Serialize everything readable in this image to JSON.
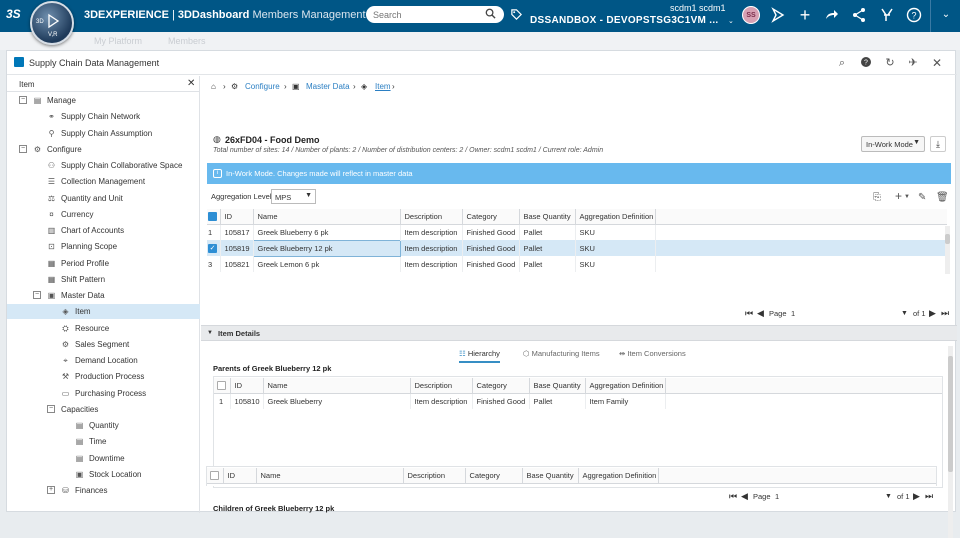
{
  "topbar": {
    "brand": "3DEXPERIENCE",
    "app": "3DDashboard",
    "dashboard": "Members Management",
    "search_placeholder": "Search",
    "user": "scdm1 scdm1",
    "tenant": "DSSANDBOX - DEVOPSTSG3C1VM ...",
    "avatar_initials": "SS",
    "compass_labels": [
      "3D",
      "V,R"
    ],
    "ghost_tabs": [
      "My Platform",
      "Members"
    ]
  },
  "panel": {
    "title": "Supply Chain Data Management"
  },
  "tree": {
    "header": "Item",
    "nodes": [
      {
        "label": "Manage",
        "level": 0,
        "toggle": "−",
        "icon": "manage-icon"
      },
      {
        "label": "Supply Chain Network",
        "level": 1,
        "icon": "network-icon"
      },
      {
        "label": "Supply Chain Assumption",
        "level": 1,
        "icon": "assumption-icon"
      },
      {
        "label": "Configure",
        "level": 0,
        "toggle": "−",
        "icon": "gear-icon"
      },
      {
        "label": "Supply Chain Collaborative Space",
        "level": 1,
        "icon": "space-icon"
      },
      {
        "label": "Collection Management",
        "level": 1,
        "icon": "collection-icon"
      },
      {
        "label": "Quantity and Unit",
        "level": 1,
        "icon": "quantity-icon"
      },
      {
        "label": "Currency",
        "level": 1,
        "icon": "currency-icon"
      },
      {
        "label": "Chart of Accounts",
        "level": 1,
        "icon": "accounts-icon"
      },
      {
        "label": "Planning Scope",
        "level": 1,
        "icon": "scope-icon"
      },
      {
        "label": "Period Profile",
        "level": 1,
        "icon": "period-icon"
      },
      {
        "label": "Shift Pattern",
        "level": 1,
        "icon": "shift-icon"
      },
      {
        "label": "Master Data",
        "level": 1,
        "toggle": "−",
        "icon": "master-data-icon"
      },
      {
        "label": "Item",
        "level": 2,
        "icon": "item-icon",
        "selected": true
      },
      {
        "label": "Resource",
        "level": 2,
        "icon": "resource-icon"
      },
      {
        "label": "Sales Segment",
        "level": 2,
        "icon": "segment-icon"
      },
      {
        "label": "Demand Location",
        "level": 2,
        "icon": "location-icon"
      },
      {
        "label": "Production Process",
        "level": 2,
        "icon": "process-icon"
      },
      {
        "label": "Purchasing Process",
        "level": 2,
        "icon": "purchase-icon"
      },
      {
        "label": "Capacities",
        "level": 2,
        "toggle": "−",
        "icon": ""
      },
      {
        "label": "Quantity",
        "level": 3,
        "icon": "calendar-icon"
      },
      {
        "label": "Time",
        "level": 3,
        "icon": "calendar-icon"
      },
      {
        "label": "Downtime",
        "level": 3,
        "icon": "calendar-icon"
      },
      {
        "label": "Stock Location",
        "level": 3,
        "icon": "stock-icon"
      },
      {
        "label": "Finances",
        "level": 2,
        "toggle": "+",
        "icon": "finance-icon"
      }
    ]
  },
  "breadcrumb": {
    "configure": "Configure",
    "master_data": "Master Data",
    "item": "Item"
  },
  "site": {
    "title": "26xFD04 - Food Demo",
    "info": "Total number of sites: 14 / Number of plants: 2 / Number of distribution centers: 2 / Owner: scdm1 scdm1 / Current role: Admin",
    "mode": "In-Work Mode"
  },
  "banner": "In-Work Mode. Changes made will reflect in master data",
  "aggregation": {
    "label": "Aggregation Level",
    "value": "MPS"
  },
  "items_table": {
    "columns": [
      "ID",
      "Name",
      "Description",
      "Category",
      "Base Quantity",
      "Aggregation Definition"
    ],
    "rows": [
      {
        "n": "1",
        "id": "105817",
        "name": "Greek Blueberry 6 pk",
        "desc": "Item description",
        "cat": "Finished Good",
        "qty": "Pallet",
        "agg": "SKU"
      },
      {
        "n": "2",
        "id": "105819",
        "name": "Greek Blueberry 12 pk",
        "desc": "Item description",
        "cat": "Finished Good",
        "qty": "Pallet",
        "agg": "SKU",
        "selected": true
      },
      {
        "n": "3",
        "id": "105821",
        "name": "Greek Lemon 6 pk",
        "desc": "Item description",
        "cat": "Finished Good",
        "qty": "Pallet",
        "agg": "SKU"
      }
    ]
  },
  "pager": {
    "page_label": "Page",
    "page": "1",
    "of": "of 1"
  },
  "details": {
    "title": "Item Details",
    "tabs": [
      "Hierarchy",
      "Manufacturing Items",
      "Item Conversions"
    ],
    "parents_title": "Parents of Greek Blueberry 12 pk",
    "children_title": "Children of Greek Blueberry 12 pk",
    "columns": [
      "ID",
      "Name",
      "Description",
      "Category",
      "Base Quantity",
      "Aggregation Definition"
    ],
    "parent_rows": [
      {
        "n": "1",
        "id": "105810",
        "name": "Greek Blueberry",
        "desc": "Item description",
        "cat": "Finished Good",
        "qty": "Pallet",
        "agg": "Item Family"
      }
    ]
  }
}
